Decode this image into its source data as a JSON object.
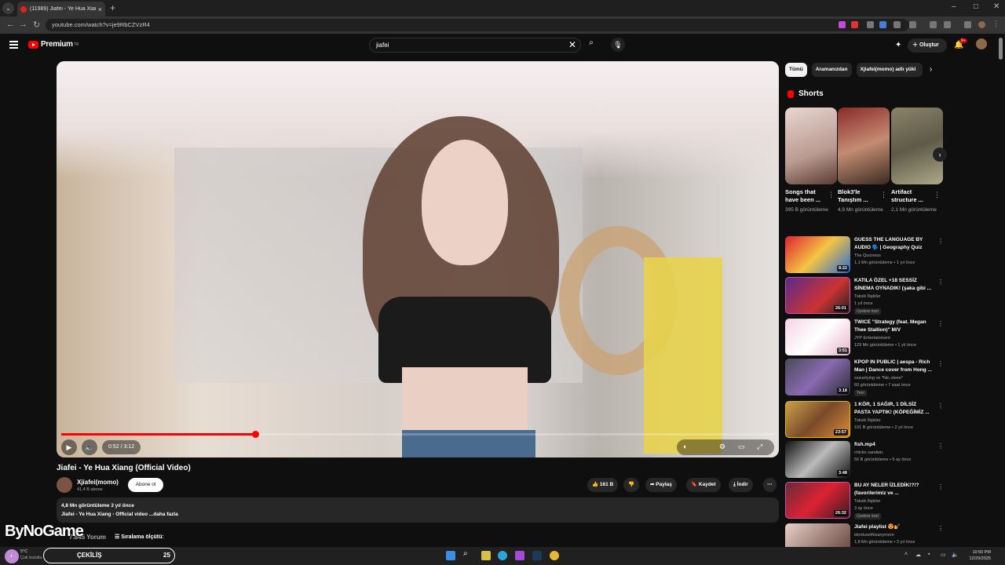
{
  "browser": {
    "tab_title": "(11989) Jiafei - Ye Hua Xiang (O",
    "tab_close": "×",
    "new_tab": "+",
    "url": "youtube.com/watch?v=je9RbCZVzR4",
    "window_controls": [
      "–",
      "□",
      "✕"
    ]
  },
  "header": {
    "logo": "Premium",
    "logo_sup": "TR",
    "search_value": "jiafei",
    "create_label": "Oluştur",
    "notif_count": "9+"
  },
  "player": {
    "time": "0:52 / 3:12",
    "progress": 0.272,
    "colors": {
      "progress": "#ff0000"
    }
  },
  "video": {
    "title": "Jiafei - Ye Hua Xiang (Official Video)",
    "channel": "Xjiafei(momo)",
    "subscribers": "41,4 B abone",
    "subscribe": "Abone ol",
    "likes": "161 B",
    "share": "Paylaş",
    "save": "Kaydet",
    "download": "İndir",
    "views_line": "4,8 Mn görüntüleme  3 yıl önce",
    "desc_line": "Jiafei - Ye Hua Xiang - Official video ...daha fazla"
  },
  "comments": {
    "count": "7.845 Yorum",
    "sort": "Sıralama ölçütü:"
  },
  "watermark": "ByNoGame",
  "chips": [
    "Tümü",
    "Aramanızdan",
    "Xjiafei(momo) adlı yükl"
  ],
  "shorts": {
    "heading": "Shorts",
    "items": [
      {
        "title": "Songs that have been ...",
        "views": "395 B görüntüleme"
      },
      {
        "title": "Blok3'le Tanıştım ...",
        "views": "4,9 Mn görüntüleme"
      },
      {
        "title": "Artifact structure ...",
        "views": "2,1 Mn görüntüleme"
      }
    ]
  },
  "recommendations": [
    {
      "title": "GUESS THE LANGUAGE BY AUDIO 🗣️ | Geography Quiz",
      "channel": "The Quizness",
      "meta": "1,1 Mn görüntüleme • 1 yıl önce",
      "duration": "8:22",
      "badge": ""
    },
    {
      "title": "KATILA ÖZEL +18 SESSİZ SİNEMA OYNADIK! (şaka gibi ...",
      "channel": "Toksik İlişkiler",
      "meta": "1 yıl önce",
      "duration": "26:01",
      "badge": "Üyelere özel"
    },
    {
      "title": "TWICE \"Strategy (feat. Megan Thee Stallion)\" M/V",
      "channel": "JYP Entertainment",
      "meta": "129 Mn görüntüleme • 1 yıl önce",
      "duration": "3:51",
      "badge": ""
    },
    {
      "title": "KPOP IN PUBLIC | aespa - Rich Man | Dance cover from Hong ...",
      "channel": "sssuetying ve *Nic.oleee*",
      "meta": "60 görüntüleme • 7 saat önce",
      "duration": "3:18",
      "badge": "Yeni"
    },
    {
      "title": "1 KÖR, 1 SAĞIR, 1 DİLSİZ PASTA YAPTIK! (KÖPEĞİMİZ ...",
      "channel": "Toksik İlişkiler",
      "meta": "101 B görüntüleme • 2 yıl önce",
      "duration": "23:57",
      "badge": ""
    },
    {
      "title": "fish.mp4",
      "channel": "chickn sandwic",
      "meta": "56 B görüntüleme • 5 ay önce",
      "duration": "3:48",
      "badge": ""
    },
    {
      "title": "BU AY NELER İZLEDİK!?!? (favorilerimiz ve ...",
      "channel": "Toksik İlişkiler",
      "meta": "3 ay önce",
      "duration": "26:32",
      "badge": "Üyelere özel"
    },
    {
      "title": "Jiafei playlist 😍💅",
      "channel": "idontusethisanymore",
      "meta": "1,8 Mn görüntüleme • 3 yıl önce",
      "duration": "",
      "badge": ""
    }
  ],
  "taskbar": {
    "temp": "5°C",
    "weather": "Çok bulutlu",
    "giveaway_label": "ÇEKİLİŞ",
    "giveaway_count": "25",
    "time": "10:50 PM",
    "date": "12/29/2025"
  }
}
